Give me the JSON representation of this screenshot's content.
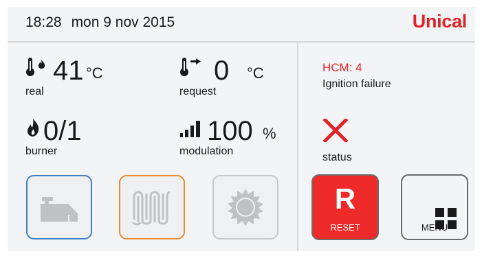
{
  "header": {
    "time": "18:28",
    "date": "mon 9 nov 2015",
    "brand": "Unical"
  },
  "metrics": {
    "real": {
      "value": "41",
      "unit": "°C",
      "label": "real",
      "icon": "thermometer-flame-icon"
    },
    "request": {
      "value": "0",
      "unit": "°C",
      "label": "request",
      "icon": "thermometer-arrow-icon"
    },
    "burner": {
      "value": "0/1",
      "label": "burner",
      "icon": "flame-icon"
    },
    "modulation": {
      "value": "100",
      "unit": "%",
      "label": "modulation",
      "icon": "signal-bars-icon"
    }
  },
  "alarm": {
    "code": "HCM:  4",
    "description": "Ignition failure",
    "status_label": "status",
    "status_icon": "error-x-icon"
  },
  "buttons": {
    "tap": {
      "icon": "tap-water-icon"
    },
    "heating": {
      "icon": "radiator-icon"
    },
    "sun": {
      "icon": "sun-icon"
    },
    "reset": {
      "letter": "R",
      "label": "RESET"
    },
    "menu": {
      "label": "MENU",
      "icon": "grid-icon"
    }
  },
  "colors": {
    "brand": "#e0242a",
    "alarm": "#e0242a",
    "reset_bg": "#ee2a2a",
    "tap_border": "#3f7fc4",
    "heating_border": "#f08a2e",
    "panel_bg": "#f3f4f5"
  }
}
